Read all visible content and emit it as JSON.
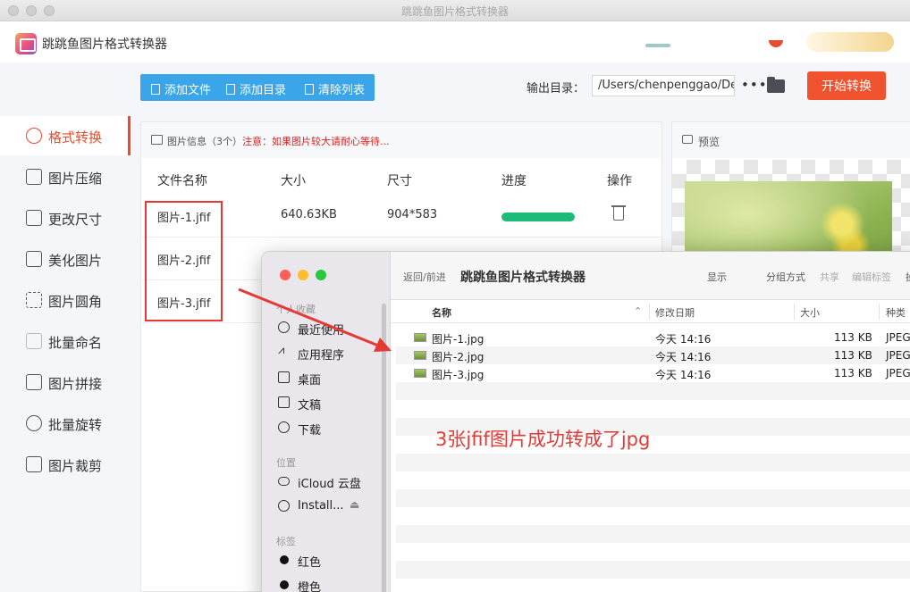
{
  "window": {
    "title": "跳跳鱼图片格式转换器"
  },
  "app": {
    "name": "跳跳鱼图片格式转换器"
  },
  "sidebar": {
    "items": [
      {
        "label": "格式转换",
        "icon": "convert-icon",
        "active": true
      },
      {
        "label": "图片压缩",
        "icon": "compress-icon"
      },
      {
        "label": "更改尺寸",
        "icon": "resize-icon"
      },
      {
        "label": "美化图片",
        "icon": "beautify-icon"
      },
      {
        "label": "图片圆角",
        "icon": "rounded-corner-icon"
      },
      {
        "label": "批量命名",
        "icon": "rename-icon"
      },
      {
        "label": "图片拼接",
        "icon": "stitch-icon"
      },
      {
        "label": "批量旋转",
        "icon": "rotate-icon"
      },
      {
        "label": "图片裁剪",
        "icon": "crop-icon"
      }
    ]
  },
  "toolbar": {
    "add_file": "添加文件",
    "add_folder": "添加目录",
    "clear_list": "清除列表",
    "output_label": "输出目录：",
    "output_path": "/Users/chenpenggao/Desktop",
    "more": "•••",
    "start": "开始转换"
  },
  "file_panel": {
    "info_title": "图片信息（3个）",
    "info_note": "注意：如果图片较大请耐心等待...",
    "columns": [
      "文件名称",
      "大小",
      "尺寸",
      "进度",
      "操作"
    ],
    "rows": [
      {
        "name": "图片-1.jfif",
        "size": "640.63KB",
        "dimension": "904*583",
        "progress": 1.0
      },
      {
        "name": "图片-2.jfif",
        "size": "",
        "dimension": "",
        "progress": null
      },
      {
        "name": "图片-3.jfif",
        "size": "",
        "dimension": "",
        "progress": null
      }
    ]
  },
  "preview": {
    "title": "预览"
  },
  "finder": {
    "nav": "返回/前进",
    "title": "跳跳鱼图片格式转换器",
    "tools": [
      "显示",
      "分组方式",
      "共享",
      "编辑标签",
      "操"
    ],
    "sections": {
      "favorites": "个人收藏",
      "locations": "位置",
      "tags": "标签"
    },
    "favorites": [
      "最近使用",
      "应用程序",
      "桌面",
      "文稿",
      "下载"
    ],
    "locations": [
      "iCloud 云盘",
      "Install..."
    ],
    "tags": [
      "红色",
      "橙色"
    ],
    "columns": [
      "名称",
      "修改日期",
      "大小",
      "种类"
    ],
    "files": [
      {
        "name": "图片-1.jpg",
        "date": "今天 14:16",
        "size": "113 KB",
        "kind": "JPEG"
      },
      {
        "name": "图片-2.jpg",
        "date": "今天 14:16",
        "size": "113 KB",
        "kind": "JPEG"
      },
      {
        "name": "图片-3.jpg",
        "date": "今天 14:16",
        "size": "113 KB",
        "kind": "JPEG"
      }
    ]
  },
  "annotation": {
    "text": "3张jfif图片成功转成了jpg",
    "color": "#e53935"
  },
  "colors": {
    "accent": "#f0522d",
    "toolbar": "#3aa5e8",
    "progress": "#1dbb76"
  }
}
